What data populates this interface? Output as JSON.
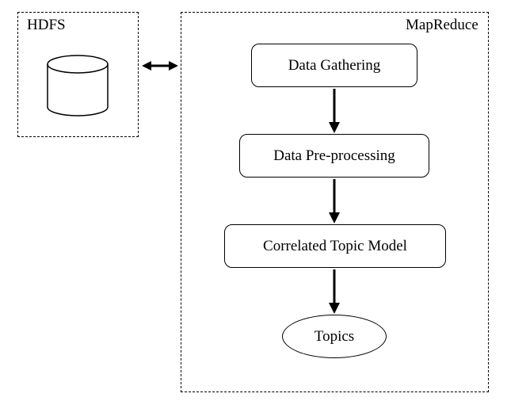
{
  "hdfs": {
    "label": "HDFS"
  },
  "mapreduce": {
    "label": "MapReduce"
  },
  "steps": {
    "gathering": "Data Gathering",
    "preprocess": "Data Pre-processing",
    "ctm": "Correlated Topic Model",
    "topics": "Topics"
  }
}
